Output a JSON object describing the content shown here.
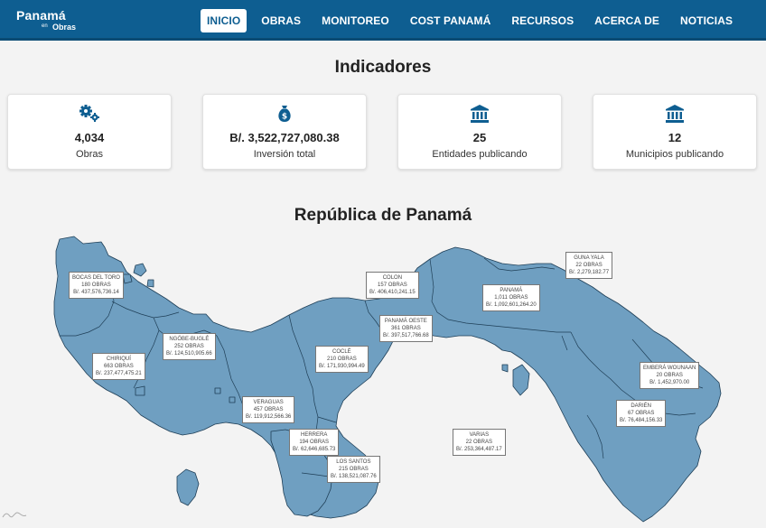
{
  "nav": {
    "logo": {
      "line1": "Panamá",
      "line2": "en",
      "line3": "Obras"
    },
    "items": [
      {
        "label": "INICIO",
        "active": true
      },
      {
        "label": "OBRAS"
      },
      {
        "label": "MONITOREO"
      },
      {
        "label": "COST PANAMÁ"
      },
      {
        "label": "RECURSOS"
      },
      {
        "label": "ACERCA DE"
      },
      {
        "label": "NOTICIAS"
      }
    ]
  },
  "indicators": {
    "title": "Indicadores",
    "cards": [
      {
        "icon": "gears-icon",
        "value": "4,034",
        "label": "Obras"
      },
      {
        "icon": "money-bag-icon",
        "value": "B/. 3,522,727,080.38",
        "label": "Inversión total"
      },
      {
        "icon": "institution-icon",
        "value": "25",
        "label": "Entidades publicando"
      },
      {
        "icon": "institution-icon",
        "value": "12",
        "label": "Municipios publicando"
      }
    ]
  },
  "map": {
    "title": "República de Panamá",
    "colors": {
      "fill": "#6f9fc1",
      "stroke": "#1f3f57",
      "accent": "#0e5e91"
    },
    "regions": [
      {
        "name": "BOCAS DEL TORO",
        "obras": "180 OBRAS",
        "amount": "B/. 437,576,736.14"
      },
      {
        "name": "COLON",
        "obras": "157 OBRAS",
        "amount": "B/. 406,410,241.15"
      },
      {
        "name": "GUNA YALA",
        "obras": "22 OBRAS",
        "amount": "B/. 2,279,182.77"
      },
      {
        "name": "PANAMÁ",
        "obras": "1,011 OBRAS",
        "amount": "B/. 1,092,601,264.20"
      },
      {
        "name": "PANAMÁ OESTE",
        "obras": "361 OBRAS",
        "amount": "B/. 397,517,766.68"
      },
      {
        "name": "NGÖBE-BUGLÉ",
        "obras": "252 OBRAS",
        "amount": "B/. 124,510,905.66"
      },
      {
        "name": "CHIRIQUÍ",
        "obras": "663 OBRAS",
        "amount": "B/. 237,477,475.21"
      },
      {
        "name": "COCLÉ",
        "obras": "210 OBRAS",
        "amount": "B/. 171,930,994.49"
      },
      {
        "name": "VERAGUAS",
        "obras": "457 OBRAS",
        "amount": "B/. 119,912,566.36"
      },
      {
        "name": "EMBERÁ WOUNAAN",
        "obras": "20 OBRAS",
        "amount": "B/. 1,452,970.00"
      },
      {
        "name": "DARIÉN",
        "obras": "67 OBRAS",
        "amount": "B/. 76,484,156.33"
      },
      {
        "name": "HERRERA",
        "obras": "194 OBRAS",
        "amount": "B/. 62,646,685.73"
      },
      {
        "name": "VARIAS",
        "obras": "22 OBRAS",
        "amount": "B/. 253,364,487.17"
      },
      {
        "name": "LOS SANTOS",
        "obras": "215 OBRAS",
        "amount": "B/. 138,521,087.76"
      }
    ]
  }
}
